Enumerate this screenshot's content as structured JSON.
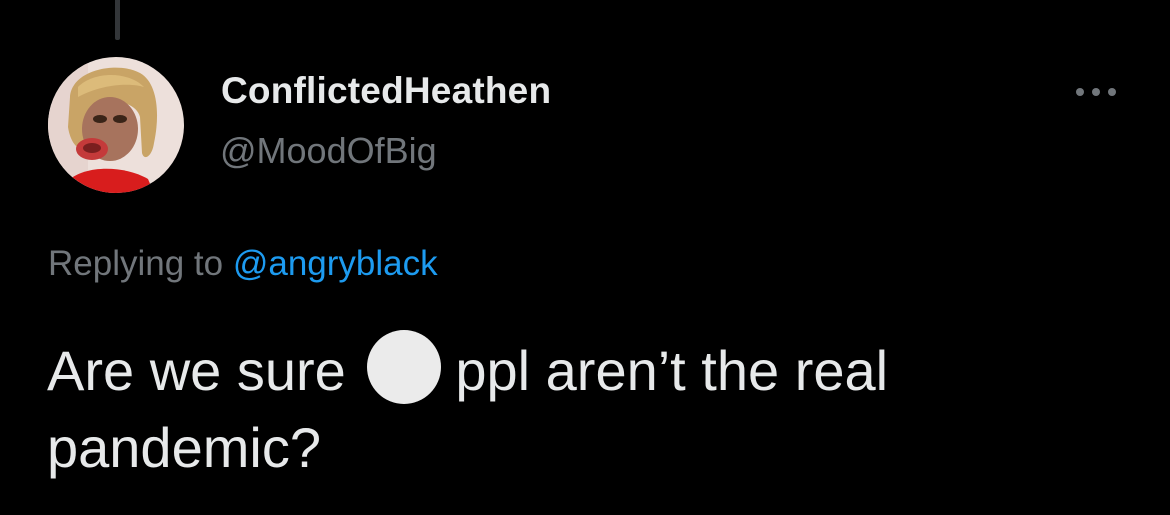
{
  "tweet": {
    "author": {
      "display_name": "ConflictedHeathen",
      "handle": "@MoodOfBig"
    },
    "reply_context": {
      "prefix": "Replying to",
      "mention": "@angryblack"
    },
    "text_before_emoji": "Are we sure",
    "emoji": "white-circle-emoji",
    "text_after_emoji": "ppl aren’t the real pandemic?",
    "more_icon": "more-horizontal-icon"
  },
  "colors": {
    "background": "#000000",
    "primary_text": "#e7e9ea",
    "secondary_text": "#71767b",
    "link": "#1d9bf0"
  }
}
